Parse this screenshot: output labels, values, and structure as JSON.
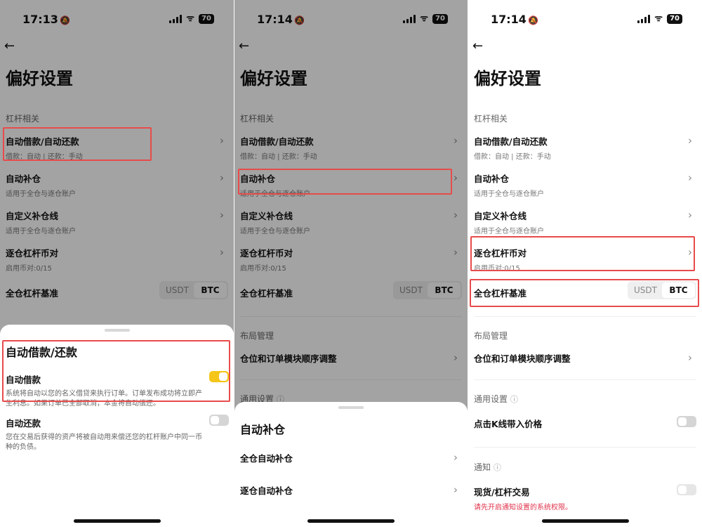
{
  "screens": [
    {
      "status": {
        "time": "17:13",
        "battery": "70"
      },
      "title": "偏好设置",
      "sections": {
        "leverage": "杠杆相关"
      },
      "items": {
        "auto_borrow": {
          "title": "自动借款/自动还款",
          "sub": "借款：自动 | 还款：手动"
        },
        "auto_margin": {
          "title": "自动补仓",
          "sub": "适用于全仓与逐仓账户"
        },
        "custom_margin": {
          "title": "自定义补仓线",
          "sub": "适用于全仓与逐仓账户"
        },
        "isolated_pairs": {
          "title": "逐仓杠杆币对",
          "sub": "启用币对:0/15"
        },
        "cross_base": {
          "title": "全仓杠杆基准",
          "options": [
            "USDT",
            "BTC"
          ],
          "selected": "BTC"
        }
      },
      "sheet": {
        "title": "自动借款/还款",
        "items": [
          {
            "title": "自动借款",
            "desc": "系统将自动以您的名义借贷来执行订单。订单发布成功将立即产生利息。如果订单已全部取消，本金将自动偿还。",
            "on": true
          },
          {
            "title": "自动还款",
            "desc": "您在交易后获得的资产将被自动用来偿还您的杠杆账户中同一币种的负债。",
            "on": false
          }
        ]
      }
    },
    {
      "status": {
        "time": "17:14",
        "battery": "70"
      },
      "title": "偏好设置",
      "sections": {
        "leverage": "杠杆相关",
        "layout": "布局管理",
        "general": "通用设置"
      },
      "items": {
        "auto_borrow": {
          "title": "自动借款/自动还款",
          "sub": "借款：自动 | 还款：手动"
        },
        "auto_margin": {
          "title": "自动补仓",
          "sub": "适用于全仓与逐仓账户"
        },
        "custom_margin": {
          "title": "自定义补仓线",
          "sub": "适用于全仓与逐仓账户"
        },
        "isolated_pairs": {
          "title": "逐仓杠杆币对",
          "sub": "启用币对:0/15"
        },
        "cross_base": {
          "title": "全仓杠杆基准",
          "options": [
            "USDT",
            "BTC"
          ],
          "selected": "BTC"
        },
        "order_layout": {
          "title": "仓位和订单模块顺序调整"
        }
      },
      "sheet": {
        "title": "自动补仓",
        "items": [
          {
            "title": "全仓自动补仓"
          },
          {
            "title": "逐仓自动补仓"
          }
        ]
      }
    },
    {
      "status": {
        "time": "17:14",
        "battery": "70"
      },
      "title": "偏好设置",
      "sections": {
        "leverage": "杠杆相关",
        "layout": "布局管理",
        "general": "通用设置",
        "notify": "通知"
      },
      "items": {
        "auto_borrow": {
          "title": "自动借款/自动还款",
          "sub": "借款：自动 | 还款：手动"
        },
        "auto_margin": {
          "title": "自动补仓",
          "sub": "适用于全仓与逐仓账户"
        },
        "custom_margin": {
          "title": "自定义补仓线",
          "sub": "适用于全仓与逐仓账户"
        },
        "isolated_pairs": {
          "title": "逐仓杠杆币对",
          "sub": "启用币对:0/15"
        },
        "cross_base": {
          "title": "全仓杠杆基准",
          "options": [
            "USDT",
            "BTC"
          ],
          "selected": "BTC"
        },
        "order_layout": {
          "title": "仓位和订单模块顺序调整"
        },
        "kline_price": {
          "title": "点击K线带入价格",
          "on": false
        },
        "spot_trade": {
          "title": "现货/杠杆交易",
          "sub": "请先开启通知设置的系统权限。",
          "on": false
        }
      }
    }
  ],
  "colors": {
    "highlight": "#e84b4b",
    "toggle_on": "#f5c518",
    "warning": "#e0324b"
  },
  "icons": {
    "back": "back-arrow-icon",
    "chevron": "chevron-right-icon",
    "info": "info-icon",
    "mute": "bell-slash-icon"
  }
}
